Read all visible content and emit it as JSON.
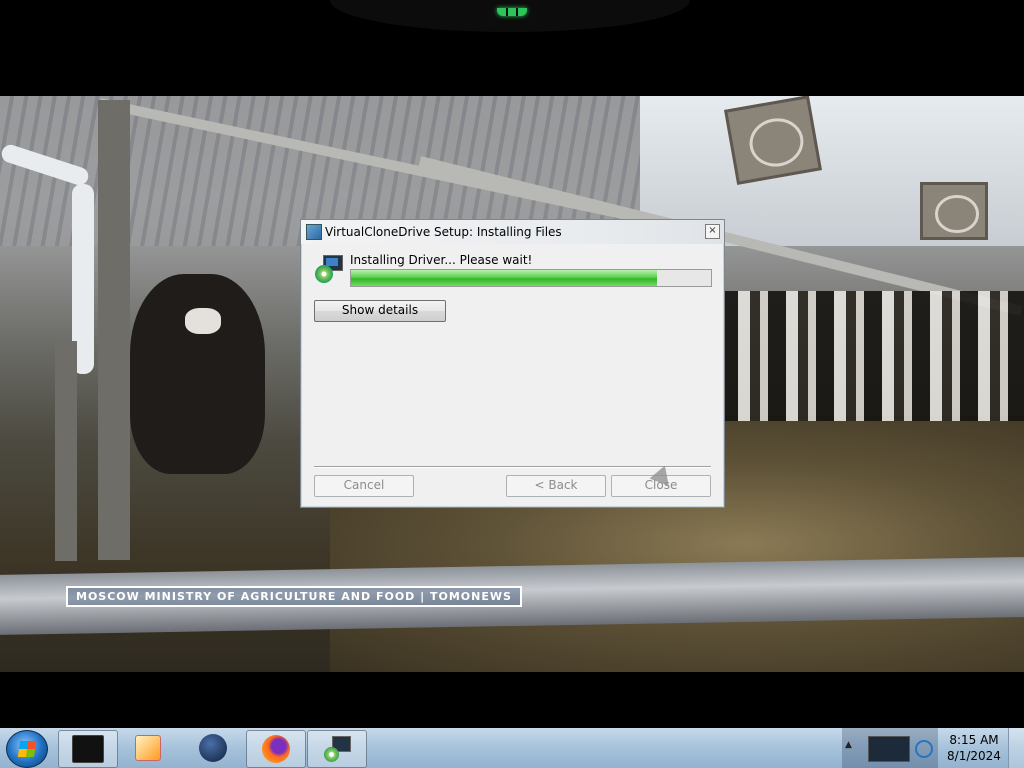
{
  "video": {
    "watermark": "MOSCOW MINISTRY OF AGRICULTURE AND FOOD | TOMONEWS"
  },
  "dialog": {
    "title": "VirtualCloneDrive Setup: Installing Files",
    "close_label": "×",
    "status": "Installing Driver... Please wait!",
    "progress_percent": 85,
    "show_details_label": "Show details",
    "cancel_label": "Cancel",
    "back_label": "< Back",
    "close_button_label": "Close"
  },
  "taskbar": {
    "time": "8:15 AM",
    "date": "8/1/2024",
    "items": [
      {
        "name": "terminal-app",
        "icon": "monitor-icon"
      },
      {
        "name": "media-player-app",
        "icon": "media-player-icon"
      },
      {
        "name": "globe-app",
        "icon": "globe-icon"
      },
      {
        "name": "firefox-app",
        "icon": "firefox-icon"
      },
      {
        "name": "virtualclonedrive-setup-app",
        "icon": "setup-icon"
      }
    ],
    "tray_expand": "▲"
  }
}
